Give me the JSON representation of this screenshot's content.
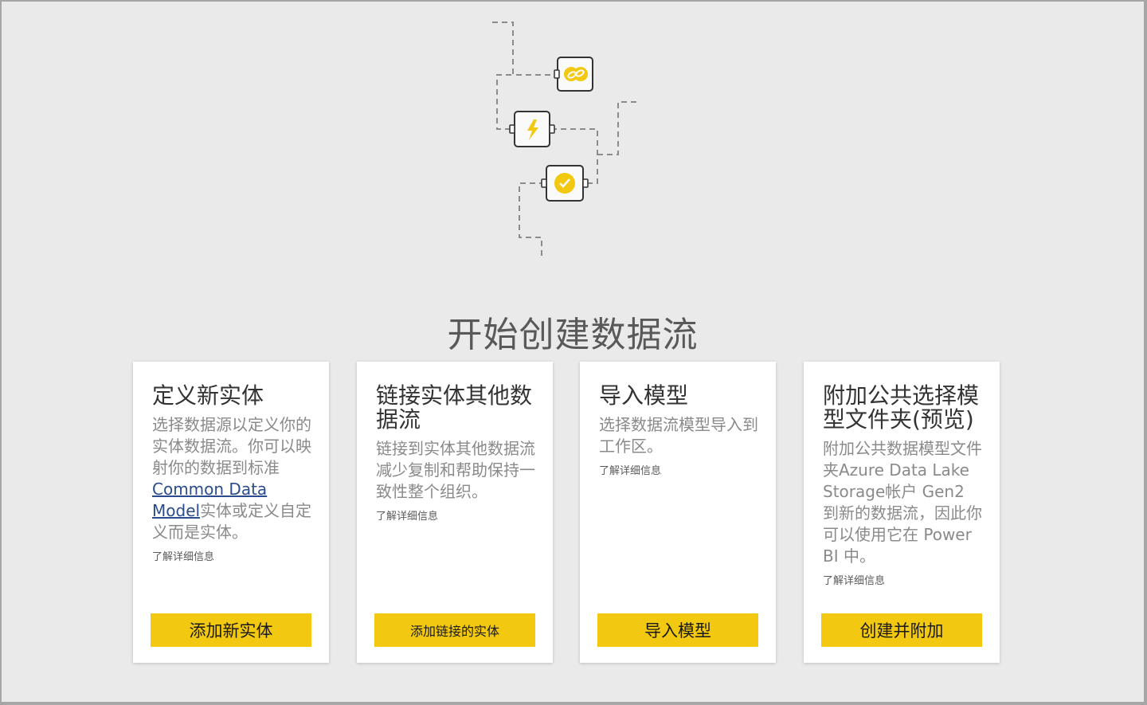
{
  "heading": "开始创建数据流",
  "colors": {
    "accent": "#f2c811",
    "link": "#2b4c8c",
    "background": "#eaeaea",
    "card": "#ffffff"
  },
  "illustration": {
    "icons": [
      "link-icon",
      "lightning-icon",
      "verified-badge-icon"
    ]
  },
  "cards": [
    {
      "title": "定义新实体",
      "desc_before": "选择数据源以定义你的实体数据流。你可以映射你的数据到标准",
      "desc_link": "Common Data Model",
      "desc_after": "实体或定义自定义而是实体。",
      "learn": "了解详细信息",
      "button": "添加新实体"
    },
    {
      "title": "链接实体其他数据流",
      "desc": "链接到实体其他数据流减少复制和帮助保持一致性整个组织。",
      "learn": "了解详细信息",
      "button": "添加链接的实体"
    },
    {
      "title": "导入模型",
      "desc": "选择数据流模型导入到工作区。",
      "learn": "了解详细信息",
      "button": "导入模型"
    },
    {
      "title": "附加公共选择模型文件夹(预览)",
      "desc": "附加公共数据模型文件夹Azure Data Lake Storage帐户 Gen2 到新的数据流，因此你可以使用它在 Power BI 中。",
      "learn": "了解详细信息",
      "button": "创建并附加"
    }
  ]
}
